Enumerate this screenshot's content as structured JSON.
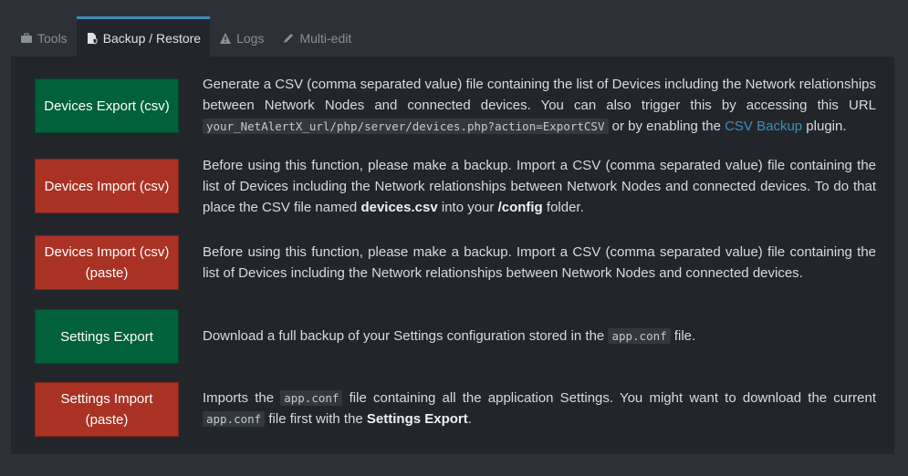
{
  "tabs": [
    {
      "label": "Tools",
      "icon": "briefcase-icon"
    },
    {
      "label": "Backup / Restore",
      "icon": "file-shield-icon",
      "active": true
    },
    {
      "label": "Logs",
      "icon": "warning-icon"
    },
    {
      "label": "Multi-edit",
      "icon": "pencil-icon"
    }
  ],
  "colors": {
    "accent": "#3c8dbc",
    "green_button": "#00613a",
    "red_button": "#a93225"
  },
  "rows": {
    "devices_export": {
      "button": "Devices Export (csv)",
      "t1": "Generate a CSV (comma separated value) file containing the list of Devices including the Network relationships between Network Nodes and connected devices. You can also trigger this by accessing this URL ",
      "code": "your_NetAlertX_url/php/server/devices.php?action=ExportCSV",
      "t2": " or by enabling the ",
      "link": "CSV Backup",
      "t3": " plugin."
    },
    "devices_import": {
      "button": "Devices Import (csv)",
      "t1": "Before using this function, please make a backup. Import a CSV (comma separated value) file containing the list of Devices including the Network relationships between Network Nodes and connected devices. To do that place the CSV file named ",
      "bold1": "devices.csv",
      "t2": " into your ",
      "bold2": "/config",
      "t3": " folder."
    },
    "devices_import_paste": {
      "button_line1": "Devices Import (csv)",
      "button_line2": "(paste)",
      "text": "Before using this function, please make a backup. Import a CSV (comma separated value) file containing the list of Devices including the Network relationships between Network Nodes and connected devices."
    },
    "settings_export": {
      "button": "Settings Export",
      "t1": "Download a full backup of your Settings configuration stored in the ",
      "code": "app.conf",
      "t2": " file."
    },
    "settings_import": {
      "button_line1": "Settings Import",
      "button_line2": "(paste)",
      "t1": "Imports the ",
      "code1": "app.conf",
      "t2": " file containing all the application Settings. You might want to download the current ",
      "code2": "app.conf",
      "t3": " file first with the ",
      "bold": "Settings Export",
      "t4": "."
    }
  }
}
